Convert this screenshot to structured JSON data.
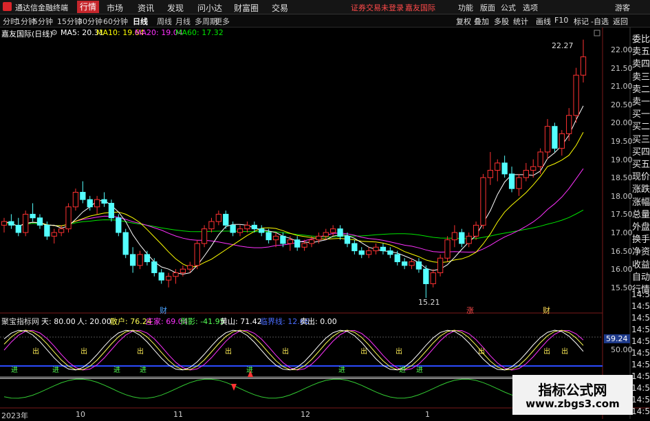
{
  "app": {
    "title": "通达信金融终端"
  },
  "menu": [
    "行情",
    "市场",
    "资讯",
    "发现",
    "问小达",
    "财富圈",
    "交易"
  ],
  "menu_active": "行情",
  "notice": "证券交易未登录",
  "stock_tab": "嘉友国际",
  "right_menu": [
    "功能",
    "版面",
    "公式",
    "选项"
  ],
  "guest": "游客",
  "periods": [
    "分时",
    "1分钟",
    "5分钟",
    "15分钟",
    "30分钟",
    "60分钟",
    "日线",
    "周线",
    "月线",
    "多周期",
    "更多"
  ],
  "period_active": "日线",
  "tools": [
    "复权",
    "叠加",
    "多股",
    "统计",
    "画线",
    "F10",
    "标记",
    "-自选",
    "返回"
  ],
  "main_info": {
    "name": "嘉友国际(日线)",
    "ma5": "MA5: 20.31",
    "ma10": "MA10: 19.64",
    "ma20": "MA20: 19.04",
    "ma60": "MA60: 17.32"
  },
  "high_label": "22.27",
  "low_label": "15.21",
  "markers": {
    "cai1": "财",
    "cai2": "财",
    "zhang": "涨"
  },
  "price_axis": [
    "22.00",
    "21.50",
    "21.00",
    "20.50",
    "20.00",
    "19.50",
    "19.00",
    "18.50",
    "18.00",
    "17.50",
    "17.00",
    "16.50",
    "16.00",
    "15.50"
  ],
  "indicator_info": {
    "name": "聚宝指标网",
    "tian": "天: 80.00",
    "ren": "人: 20.00",
    "sanhu": "散户: 76.24",
    "zhuangjia": "庄家: 69.04",
    "chuying": "倒影: -41.95",
    "huangshan": "黄山: 71.42",
    "linjie": "临界线: 12.66",
    "maichu": "卖出: 0.00"
  },
  "indicator_axis": {
    "value": "59.24",
    "mid": "50.00"
  },
  "signals": {
    "chu": "出",
    "jin": "进",
    "ding": "顶"
  },
  "side_quote": [
    "委比",
    "卖五",
    "卖四",
    "卖三",
    "卖二",
    "卖一",
    "买一",
    "买二",
    "买三",
    "买四",
    "买五",
    "现价",
    "涨跌",
    "涨幅",
    "总量",
    "外盘",
    "换手",
    "净资",
    "收益",
    "自动",
    "行情"
  ],
  "side_times": [
    "14:50",
    "14:50",
    "14:56",
    "14:56",
    "14:56",
    "14:56",
    "14:56",
    "14:56",
    "14:56",
    "14:56",
    "14:56"
  ],
  "date_axis": [
    "2023年",
    "10",
    "11",
    "12",
    "1"
  ],
  "watermark": {
    "title": "指标公式网",
    "url": "www.zbgs3.com"
  },
  "colors": {
    "up": "#ff3232",
    "down": "#54ffff",
    "ma5": "#ffffff",
    "ma10": "#ffff00",
    "ma20": "#ff32ff",
    "ma60": "#00e600",
    "bg": "#000000",
    "accent": "#c6262c"
  },
  "chart_data": {
    "type": "candlestick",
    "last_ma": {
      "MA5": 20.31,
      "MA10": 19.64,
      "MA20": 19.04,
      "MA60": 17.32
    },
    "ohlc": [
      [
        17.2,
        17.4,
        17.0,
        17.3
      ],
      [
        17.3,
        17.5,
        17.1,
        17.2
      ],
      [
        17.2,
        17.4,
        16.9,
        17.0
      ],
      [
        17.0,
        17.6,
        16.9,
        17.5
      ],
      [
        17.5,
        17.8,
        17.3,
        17.4
      ],
      [
        17.4,
        17.5,
        17.1,
        17.2
      ],
      [
        17.2,
        17.3,
        16.8,
        16.9
      ],
      [
        16.9,
        17.1,
        16.7,
        17.0
      ],
      [
        17.0,
        17.2,
        16.9,
        17.1
      ],
      [
        17.1,
        17.8,
        17.0,
        17.7
      ],
      [
        17.7,
        18.2,
        17.6,
        18.1
      ],
      [
        18.1,
        18.4,
        17.8,
        17.9
      ],
      [
        17.9,
        18.0,
        17.6,
        17.7
      ],
      [
        17.7,
        18.0,
        17.5,
        17.9
      ],
      [
        17.9,
        18.1,
        17.7,
        17.8
      ],
      [
        17.8,
        17.9,
        17.3,
        17.4
      ],
      [
        17.4,
        17.5,
        16.9,
        17.0
      ],
      [
        17.0,
        17.1,
        16.3,
        16.4
      ],
      [
        16.4,
        16.6,
        15.9,
        16.1
      ],
      [
        16.1,
        16.5,
        16.0,
        16.4
      ],
      [
        16.4,
        16.5,
        16.1,
        16.2
      ],
      [
        16.2,
        16.3,
        15.8,
        15.9
      ],
      [
        15.9,
        16.0,
        15.6,
        15.7
      ],
      [
        15.7,
        15.9,
        15.5,
        15.8
      ],
      [
        15.8,
        16.0,
        15.6,
        15.9
      ],
      [
        15.9,
        16.1,
        15.8,
        16.0
      ],
      [
        16.0,
        16.2,
        15.9,
        16.1
      ],
      [
        16.1,
        16.8,
        16.0,
        16.7
      ],
      [
        16.7,
        17.2,
        16.6,
        17.1
      ],
      [
        17.1,
        17.4,
        17.0,
        17.3
      ],
      [
        17.3,
        17.6,
        17.2,
        17.5
      ],
      [
        17.5,
        17.6,
        17.1,
        17.2
      ],
      [
        17.2,
        17.3,
        16.9,
        17.0
      ],
      [
        17.0,
        17.2,
        16.9,
        17.1
      ],
      [
        17.1,
        17.3,
        17.0,
        17.2
      ],
      [
        17.2,
        17.3,
        17.0,
        17.1
      ],
      [
        17.1,
        17.2,
        16.9,
        17.0
      ],
      [
        17.0,
        17.1,
        16.7,
        16.8
      ],
      [
        16.8,
        17.0,
        16.6,
        16.9
      ],
      [
        16.9,
        17.0,
        16.6,
        16.7
      ],
      [
        16.7,
        16.9,
        16.5,
        16.8
      ],
      [
        16.8,
        16.9,
        16.5,
        16.6
      ],
      [
        16.6,
        16.8,
        16.5,
        16.7
      ],
      [
        16.7,
        16.9,
        16.6,
        16.8
      ],
      [
        16.8,
        17.0,
        16.7,
        16.9
      ],
      [
        16.9,
        17.1,
        16.8,
        17.0
      ],
      [
        17.0,
        17.2,
        16.9,
        17.1
      ],
      [
        17.1,
        17.2,
        16.8,
        16.9
      ],
      [
        16.9,
        17.0,
        16.6,
        16.7
      ],
      [
        16.7,
        16.8,
        16.4,
        16.5
      ],
      [
        16.5,
        16.6,
        16.3,
        16.4
      ],
      [
        16.4,
        16.6,
        16.3,
        16.5
      ],
      [
        16.5,
        16.7,
        16.4,
        16.6
      ],
      [
        16.6,
        16.7,
        16.4,
        16.5
      ],
      [
        16.5,
        16.6,
        16.3,
        16.4
      ],
      [
        16.4,
        16.5,
        16.1,
        16.2
      ],
      [
        16.2,
        16.3,
        16.0,
        16.1
      ],
      [
        16.1,
        16.3,
        16.0,
        16.2
      ],
      [
        16.2,
        16.3,
        15.9,
        16.0
      ],
      [
        16.0,
        16.1,
        15.21,
        15.6
      ],
      [
        15.6,
        16.0,
        15.5,
        15.9
      ],
      [
        15.9,
        16.4,
        15.8,
        16.3
      ],
      [
        16.3,
        16.9,
        16.2,
        16.8
      ],
      [
        16.8,
        17.2,
        16.6,
        17.0
      ],
      [
        17.0,
        17.1,
        16.6,
        16.7
      ],
      [
        16.7,
        17.0,
        16.6,
        16.9
      ],
      [
        16.9,
        17.3,
        16.8,
        17.2
      ],
      [
        17.2,
        18.6,
        17.1,
        18.5
      ],
      [
        18.5,
        19.2,
        18.3,
        18.7
      ],
      [
        18.7,
        19.0,
        18.4,
        18.9
      ],
      [
        18.9,
        19.1,
        18.5,
        18.6
      ],
      [
        18.6,
        18.8,
        18.1,
        18.2
      ],
      [
        18.2,
        18.6,
        18.0,
        18.5
      ],
      [
        18.5,
        18.9,
        18.4,
        18.7
      ],
      [
        18.7,
        19.0,
        18.5,
        18.8
      ],
      [
        18.8,
        19.3,
        18.6,
        19.2
      ],
      [
        19.2,
        20.1,
        19.0,
        19.9
      ],
      [
        19.9,
        20.0,
        19.2,
        19.3
      ],
      [
        19.3,
        19.8,
        19.1,
        19.7
      ],
      [
        19.7,
        20.4,
        19.5,
        20.2
      ],
      [
        20.2,
        21.5,
        20.0,
        21.3
      ],
      [
        21.3,
        22.27,
        21.1,
        21.8
      ]
    ]
  }
}
